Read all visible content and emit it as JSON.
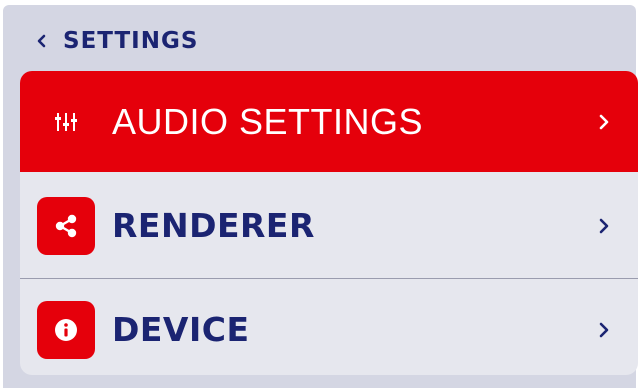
{
  "header": {
    "back_label": "SETTINGS",
    "back_icon": "chevron-left-icon"
  },
  "menu": {
    "items": [
      {
        "label": "AUDIO SETTINGS",
        "icon": "sliders-icon",
        "selected": true
      },
      {
        "label": "RENDERER",
        "icon": "share-icon",
        "selected": false
      },
      {
        "label": "DEVICE",
        "icon": "info-icon",
        "selected": false
      }
    ]
  },
  "colors": {
    "background": "#d4d6e3",
    "card": "#e6e7ee",
    "accent": "#e5000b",
    "text": "#1b2472"
  }
}
